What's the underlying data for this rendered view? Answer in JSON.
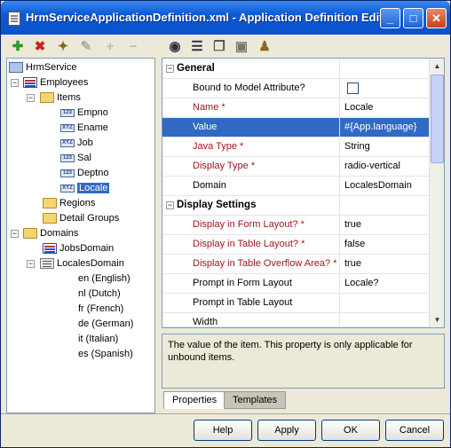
{
  "window": {
    "title": "HrmServiceApplicationDefinition.xml - Application Definition Editor",
    "controls": {
      "minimize": "_",
      "maximize": "□",
      "close": "✕"
    }
  },
  "tree_toolbar": {
    "icons": [
      "add-icon",
      "delete-icon",
      "wizard-icon",
      "edit-icon",
      "plus-icon",
      "minus-icon"
    ]
  },
  "prop_toolbar": {
    "icons": [
      "binoculars-icon",
      "sort-icon",
      "copy-icon",
      "paste-icon",
      "pin-icon"
    ]
  },
  "tree": {
    "root": "HrmService",
    "employees": "Employees",
    "items": "Items",
    "item_list": [
      "Empno",
      "Ename",
      "Job",
      "Sal",
      "Deptno",
      "Locale"
    ],
    "regions": "Regions",
    "detail_groups": "Detail Groups",
    "domains": "Domains",
    "jobs_domain": "JobsDomain",
    "locales_domain": "LocalesDomain",
    "locales": [
      "en (English)",
      "nl (Dutch)",
      "fr (French)",
      "de (German)",
      "it (Italian)",
      "es (Spanish)"
    ]
  },
  "properties": {
    "general_header": "General",
    "bound": {
      "name": "Bound to Model Attribute?",
      "value": ""
    },
    "name": {
      "name": "Name *",
      "value": "Locale"
    },
    "value": {
      "name": "Value",
      "value": "#{App.language}"
    },
    "java_type": {
      "name": "Java Type *",
      "value": "String"
    },
    "display_type": {
      "name": "Display Type *",
      "value": "radio-vertical"
    },
    "domain": {
      "name": "Domain",
      "value": "LocalesDomain"
    },
    "display_header": "Display Settings",
    "display_form": {
      "name": "Display in Form Layout? *",
      "value": "true"
    },
    "display_table": {
      "name": "Display in Table Layout? *",
      "value": "false"
    },
    "display_overflow": {
      "name": "Display in Table Overflow Area? *",
      "value": "true"
    },
    "prompt_form": {
      "name": "Prompt in Form Layout",
      "value": "Locale?"
    },
    "prompt_table": {
      "name": "Prompt in Table Layout",
      "value": ""
    },
    "width": {
      "name": "Width",
      "value": ""
    }
  },
  "description": "The value of the item. This property is only applicable for unbound items.",
  "tabs": [
    "Properties",
    "Templates"
  ],
  "buttons": {
    "help": "Help",
    "apply": "Apply",
    "ok": "OK",
    "cancel": "Cancel"
  }
}
